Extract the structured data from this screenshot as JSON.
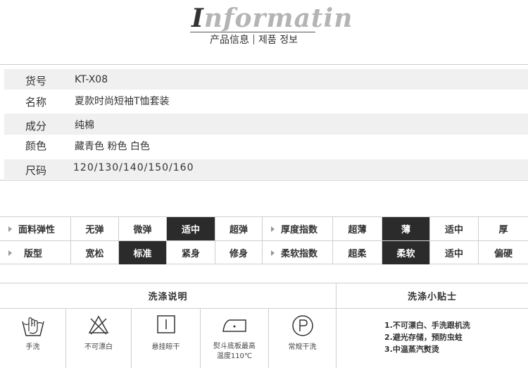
{
  "header": {
    "logo_first": "I",
    "logo_rest": "nformatin",
    "subtitle_cn": "产品信息",
    "subtitle_kr": "제품 정보"
  },
  "info": [
    {
      "label": "货号",
      "value": "KT-X08"
    },
    {
      "label": "名称",
      "value": "夏款时尚短袖T恤套装"
    },
    {
      "label": "成分",
      "value": "纯棉"
    },
    {
      "label": "颜色",
      "value": "藏青色  粉色  白色"
    },
    {
      "label": "尺码",
      "value": "120/130/140/150/160"
    }
  ],
  "attributes": {
    "row1": {
      "left_title": "面料弹性",
      "left_options": [
        "无弹",
        "微弹",
        "适中",
        "超弹"
      ],
      "left_selected": "适中",
      "right_title": "厚度指数",
      "right_options": [
        "超薄",
        "薄",
        "适中",
        "厚"
      ],
      "right_selected": "薄"
    },
    "row2": {
      "left_title": "版型",
      "left_options": [
        "宽松",
        "标准",
        "紧身",
        "修身"
      ],
      "left_selected": "标准",
      "right_title": "柔软指数",
      "right_options": [
        "超柔",
        "柔软",
        "适中",
        "偏硬"
      ],
      "right_selected": "柔软"
    }
  },
  "wash": {
    "title": "洗涤说明",
    "tips_title": "洗涤小贴士",
    "icons": [
      {
        "icon": "hand-wash-icon",
        "label": "手洗"
      },
      {
        "icon": "no-bleach-icon",
        "label": "不可漂白"
      },
      {
        "icon": "hang-dry-icon",
        "label": "悬挂晾干"
      },
      {
        "icon": "iron-icon",
        "label": "熨斗底板最高",
        "label2": "温度110℃"
      },
      {
        "icon": "dry-clean-icon",
        "label": "常规干洗"
      }
    ],
    "tips": [
      "1.不可漂白、手洗跟机洗",
      "2.避光存储，预防虫蛀",
      "3.中温蒸汽熨烫"
    ]
  }
}
